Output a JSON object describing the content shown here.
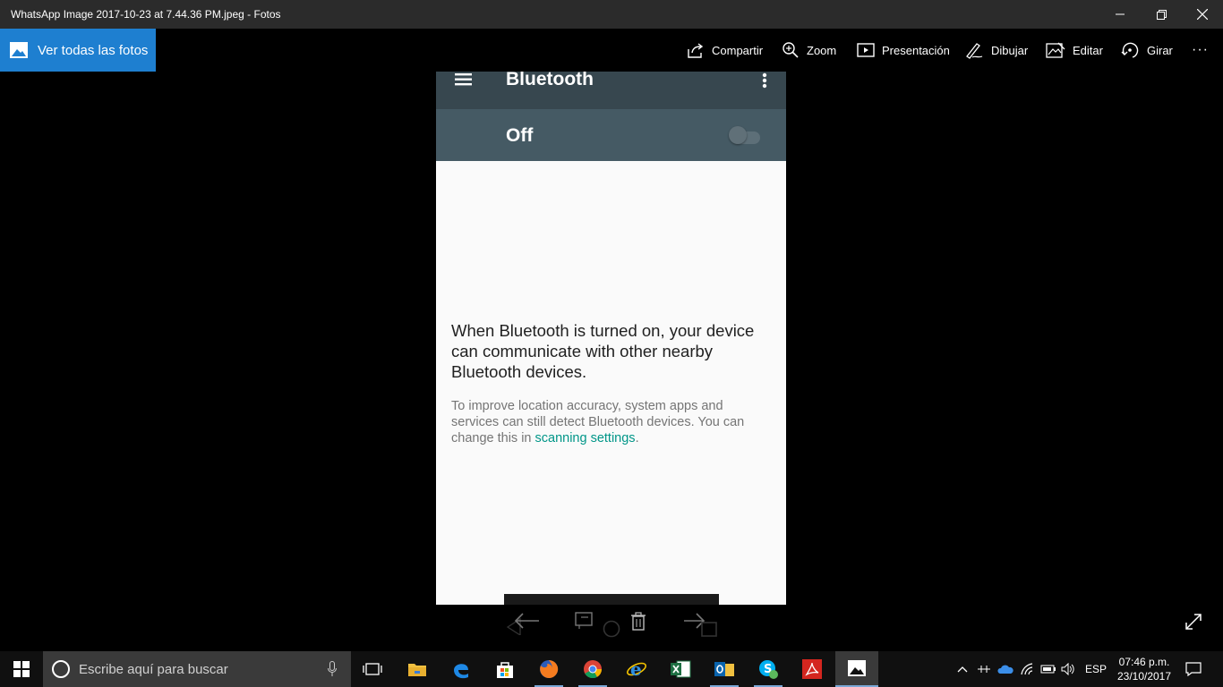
{
  "window": {
    "title": "WhatsApp Image 2017-10-23 at 7.44.36 PM.jpeg - Fotos"
  },
  "toolbar": {
    "all_photos_label": "Ver todas las fotos",
    "share_label": "Compartir",
    "zoom_label": "Zoom",
    "slideshow_label": "Presentación",
    "draw_label": "Dibujar",
    "edit_label": "Editar",
    "rotate_label": "Girar",
    "more_label": "···"
  },
  "phone": {
    "appbar_title": "Bluetooth",
    "switch_label": "Off",
    "switch_on": false,
    "main_message": "When Bluetooth is turned on, your device can communicate with other nearby Bluetooth devices.",
    "sub_message_prefix": "To improve location accuracy, system apps and services can still detect Bluetooth devices. You can change this in ",
    "sub_message_link": "scanning settings",
    "sub_message_suffix": ".",
    "colors": {
      "appbar": "#37474f",
      "switchbar": "#455a64",
      "link": "#009688"
    }
  },
  "taskbar": {
    "search_placeholder": "Escribe aquí para buscar",
    "apps": [
      "task-view-icon",
      "file-explorer-icon",
      "edge-icon",
      "store-icon",
      "firefox-icon",
      "chrome-icon",
      "internet-explorer-icon",
      "excel-icon",
      "outlook-icon",
      "skype-icon",
      "acrobat-icon",
      "photos-icon"
    ],
    "language": "ESP",
    "time": "07:46 p.m.",
    "date": "23/10/2017"
  }
}
